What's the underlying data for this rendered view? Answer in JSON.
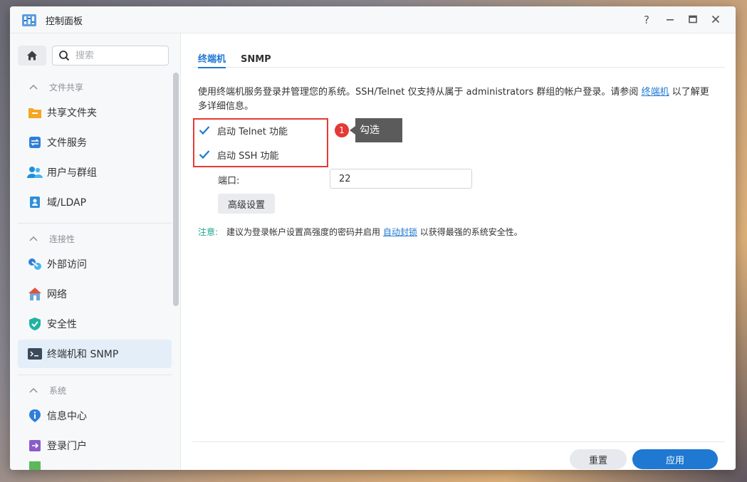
{
  "window": {
    "title": "控制面板"
  },
  "titlebar": {
    "help_label": "?",
    "minimize_label": "—",
    "maximize_label": "▣",
    "close_label": "✕"
  },
  "sidebar": {
    "search_placeholder": "搜索",
    "sections": [
      {
        "title": "文件共享",
        "items": [
          {
            "label": "共享文件夹"
          },
          {
            "label": "文件服务"
          },
          {
            "label": "用户与群组"
          },
          {
            "label": "域/LDAP"
          }
        ]
      },
      {
        "title": "连接性",
        "items": [
          {
            "label": "外部访问"
          },
          {
            "label": "网络"
          },
          {
            "label": "安全性"
          },
          {
            "label": "终端机和 SNMP"
          }
        ]
      },
      {
        "title": "系统",
        "items": [
          {
            "label": "信息中心"
          },
          {
            "label": "登录门户"
          }
        ]
      }
    ]
  },
  "tabs": [
    {
      "label": "终端机"
    },
    {
      "label": "SNMP"
    }
  ],
  "main": {
    "description_pre": "使用终端机服务登录并管理您的系统。SSH/Telnet 仅支持从属于 administrators 群组的帐户登录。请参阅 ",
    "description_link": "终端机",
    "description_post": " 以了解更多详细信息。",
    "telnet_label": "启动 Telnet 功能",
    "telnet_checked": true,
    "ssh_label": "启动 SSH 功能",
    "ssh_checked": true,
    "port_label": "端口:",
    "port_value": "22",
    "advanced_button": "高级设置",
    "note_label": "注意:",
    "note_pre": "建议为登录帐户设置高强度的密码并启用 ",
    "note_link": "自动封锁",
    "note_post": " 以获得最强的系统安全性。"
  },
  "annotation": {
    "badge_number": "1",
    "tooltip": "勾选"
  },
  "footer": {
    "reset_label": "重置",
    "apply_label": "应用"
  },
  "colors": {
    "accent": "#1f78d1",
    "highlight": "#e53935",
    "note": "#1fa58a"
  }
}
